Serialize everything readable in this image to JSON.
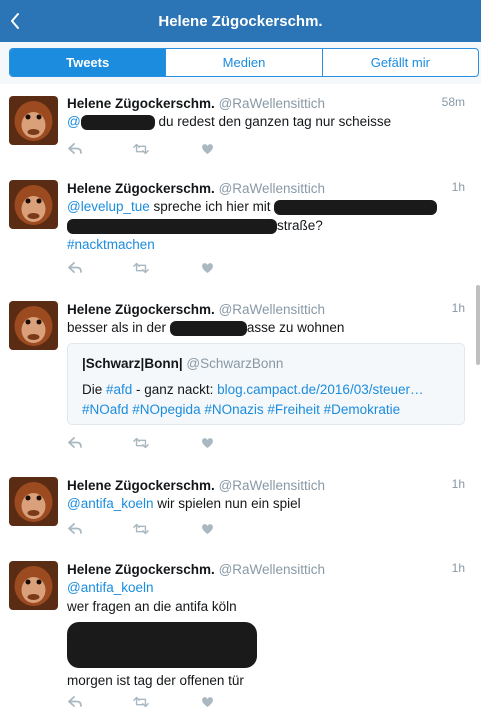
{
  "header": {
    "title": "Helene Zügockerschm."
  },
  "tabs": [
    {
      "label": "Tweets",
      "active": true
    },
    {
      "label": "Medien",
      "active": false
    },
    {
      "label": "Gefällt mir",
      "active": false
    }
  ],
  "tweets": [
    {
      "name": "Helene Zügockerschm.",
      "handle": "@RaWellensittich",
      "time": "58m",
      "mention": "@",
      "text": " du redest den ganzen tag nur scheisse"
    },
    {
      "name": "Helene Zügockerschm.",
      "handle": "@RaWellensittich",
      "time": "1h",
      "mention": "@levelup_tue",
      "text": " spreche ich hier mit ",
      "text_after": "straße?",
      "hashtag": "#nacktmachen"
    },
    {
      "name": "Helene Zügockerschm.",
      "handle": "@RaWellensittich",
      "time": "1h",
      "text_before": "besser als in der ",
      "text_after": "asse zu wohnen",
      "quote": {
        "name": "|Schwarz|Bonn|",
        "handle": "@SchwarzBonn",
        "prefix": "Die ",
        "hashtag_afd": "#afd",
        "middle": " - ganz nackt: ",
        "url": "blog.campact.de/2016/03/steuer…",
        "tags": "#NOafd #NOpegida #NOnazis #Freiheit #Demokratie"
      }
    },
    {
      "name": "Helene Zügockerschm.",
      "handle": "@RaWellensittich",
      "time": "1h",
      "mention": "@antifa_koeln",
      "text": " wir spielen nun ein spiel"
    },
    {
      "name": "Helene Zügockerschm.",
      "handle": "@RaWellensittich",
      "time": "1h",
      "mention": "@antifa_koeln",
      "line2": "wer fragen an die antifa köln",
      "line3": "morgen ist tag der offenen tür"
    }
  ],
  "colors": {
    "header_bg": "#2b74b5",
    "accent": "#1b8cde",
    "muted": "#8899a6"
  },
  "icons": [
    "back-chevron-icon",
    "reply-icon",
    "retweet-icon",
    "like-heart-icon"
  ]
}
